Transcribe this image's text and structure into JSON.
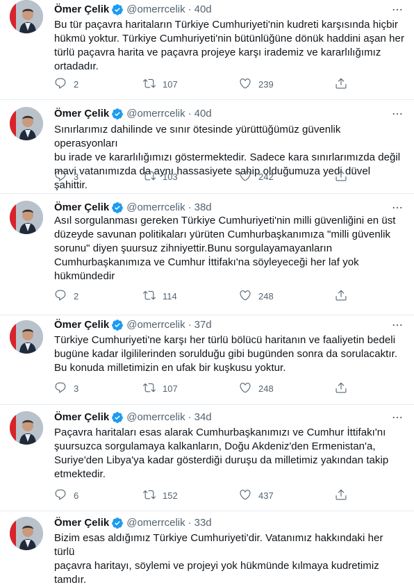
{
  "tweets": [
    {
      "name": "Ömer Çelik",
      "handle": "@omerrcelik",
      "time": "40d",
      "text": "Bu tür paçavra haritaların Türkiye Cumhuriyeti'nin kudreti karşısında hiçbir\nhükmü yoktur. Türkiye Cumhuriyeti'nin bütünlüğüne dönük haddini aşan her\ntürlü paçavra harita ve paçavra projeye karşı irademiz ve kararlılığımız\nortadadır.",
      "replies": "2",
      "retweets": "107",
      "likes": "239"
    },
    {
      "name": "Ömer Çelik",
      "handle": "@omerrcelik",
      "time": "40d",
      "text": "Sınırlarımız dahilinde ve sınır ötesinde yürüttüğümüz güvenlik operasyonları\nbu irade ve kararlılığımızı göstermektedir. Sadece kara sınırlarımızda değil\nmavi vatanımızda da aynı hassasiyete sahip olduğumuza yedi düvel şahittir.",
      "replies": "3",
      "retweets": "103",
      "likes": "242"
    },
    {
      "name": "Ömer Çelik",
      "handle": "@omerrcelik",
      "time": "38d",
      "text": "Asıl sorgulanması gereken Türkiye Cumhuriyeti'nin milli güvenliğini en üst\ndüzeyde savunan politikaları yürüten Cumhurbaşkanımıza \"milli güvenlik\nsorunu\" diyen şuursuz zihniyettir.Bunu sorgulayamayanların\nCumhurbaşkanımıza ve Cumhur İttifakı'na söyleyeceği her laf yok\nhükmündedir",
      "replies": "2",
      "retweets": "114",
      "likes": "248"
    },
    {
      "name": "Ömer Çelik",
      "handle": "@omerrcelik",
      "time": "37d",
      "text": "Türkiye Cumhuriyeti'ne karşı her türlü bölücü haritanın ve faaliyetin bedeli\nbugüne kadar ilgililerinden sorulduğu gibi bugünden sonra da sorulacaktır.\nBu konuda milletimizin en ufak bir kuşkusu yoktur.",
      "replies": "3",
      "retweets": "107",
      "likes": "248"
    },
    {
      "name": "Ömer Çelik",
      "handle": "@omerrcelik",
      "time": "34d",
      "text": "Paçavra haritaları esas alarak Cumhurbaşkanımızı ve Cumhur İttifakı'nı\nşuursuzca sorgulamaya kalkanların, Doğu Akdeniz'den Ermenistan'a,\nSuriye'den Libya'ya kadar gösterdiği duruşu da milletimiz yakından takip\netmektedir.",
      "replies": "6",
      "retweets": "152",
      "likes": "437"
    },
    {
      "name": "Ömer Çelik",
      "handle": "@omerrcelik",
      "time": "33d",
      "text": "Bizim esas aldığımız Türkiye Cumhuriyeti'dir. Vatanımız hakkındaki her türlü\npaçavra haritayı, söylemi ve projeyi yok hükmünde kılmaya kudretimiz\ntamdır.",
      "replies": "",
      "retweets": "",
      "likes": ""
    }
  ],
  "icons": {
    "verified": "verified-badge-icon",
    "more": "more-dots-icon",
    "reply": "reply-icon",
    "retweet": "retweet-icon",
    "like": "heart-icon",
    "share": "share-icon"
  },
  "colors": {
    "accent": "#1d9bf0",
    "secondary_text": "#536471",
    "divider": "#e6ecf0"
  }
}
